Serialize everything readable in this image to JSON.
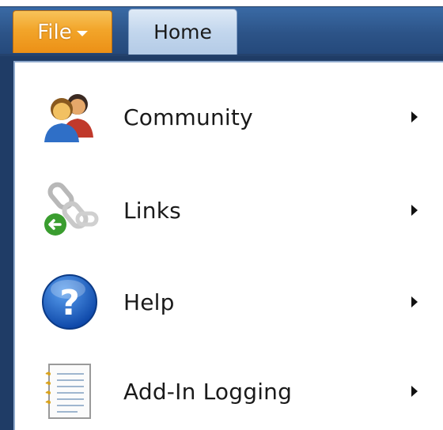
{
  "ribbon": {
    "file_tab": {
      "label": "File",
      "color": "#f2a52a"
    },
    "home_tab": {
      "label": "Home",
      "color": "#c2d6ed"
    }
  },
  "file_menu": {
    "items": [
      {
        "label": "Community",
        "icon": "community-people-icon"
      },
      {
        "label": "Links",
        "icon": "links-chain-icon"
      },
      {
        "label": "Help",
        "icon": "help-question-icon"
      },
      {
        "label": "Add-In Logging",
        "icon": "log-document-icon"
      }
    ]
  },
  "colors": {
    "frame": "#1f3c66",
    "menu_border": "#8ea9cc",
    "help_blue": "#1b63c9",
    "link_green": "#3a9d2f"
  }
}
